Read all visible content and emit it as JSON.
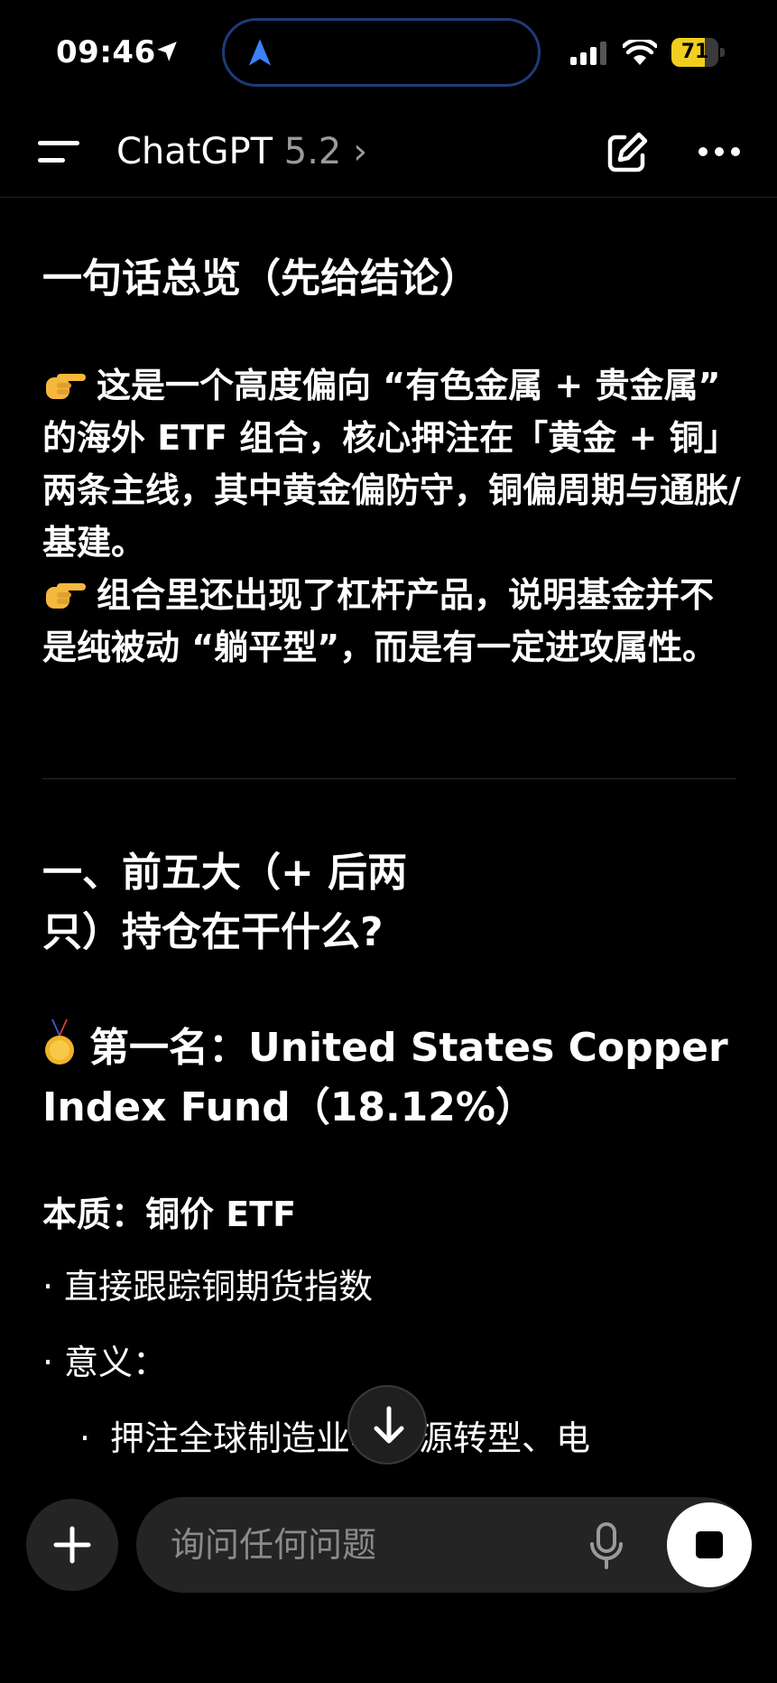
{
  "status_bar": {
    "time": "09:46",
    "battery": "71",
    "battery_level": 0.71
  },
  "header": {
    "app_name": "ChatGPT",
    "model": "5.2",
    "chevron": "›"
  },
  "content": {
    "summary_heading": "一句话总览（先给结论）",
    "para1": "这是一个高度偏向 “有色金属 + 贵金属” 的海外 ETF 组合，核心押注在「黄金 + 铜」两条主线，其中黄金偏防守，铜偏周期与通胀/基建。",
    "para2": "组合里还出现了杠杆产品，说明基金并不是纯被动 “躺平型”，而是有一定进攻属性。",
    "section1_heading": "一、前五大（+ 后两只）持仓在干什么?",
    "rank1_heading": "第一名：United States Copper Index Fund（18.12%）",
    "essence_label": "本质：铜价 ETF",
    "bullet1": "直接跟踪铜期货指数",
    "bullet2": "意义：",
    "sub_bullet1": "押注全球制造业、能源转型、电"
  },
  "composer": {
    "placeholder": "询问任何问题"
  },
  "icons": {
    "location": "location-arrow-icon",
    "navigation": "navigation-arrow-icon",
    "signal": "cellular-signal-icon",
    "wifi": "wifi-icon",
    "menu": "menu-icon",
    "edit": "new-chat-edit-icon",
    "more": "more-dots-icon",
    "hand": "pointing-hand-emoji",
    "medal": "first-place-medal-emoji",
    "scroll": "arrow-down-icon",
    "plus": "plus-icon",
    "mic": "microphone-icon",
    "stop": "stop-icon"
  },
  "colors": {
    "battery": "#f2cf1e",
    "island_border": "#1d3b78",
    "nav_arrow": "#3b82f6"
  }
}
